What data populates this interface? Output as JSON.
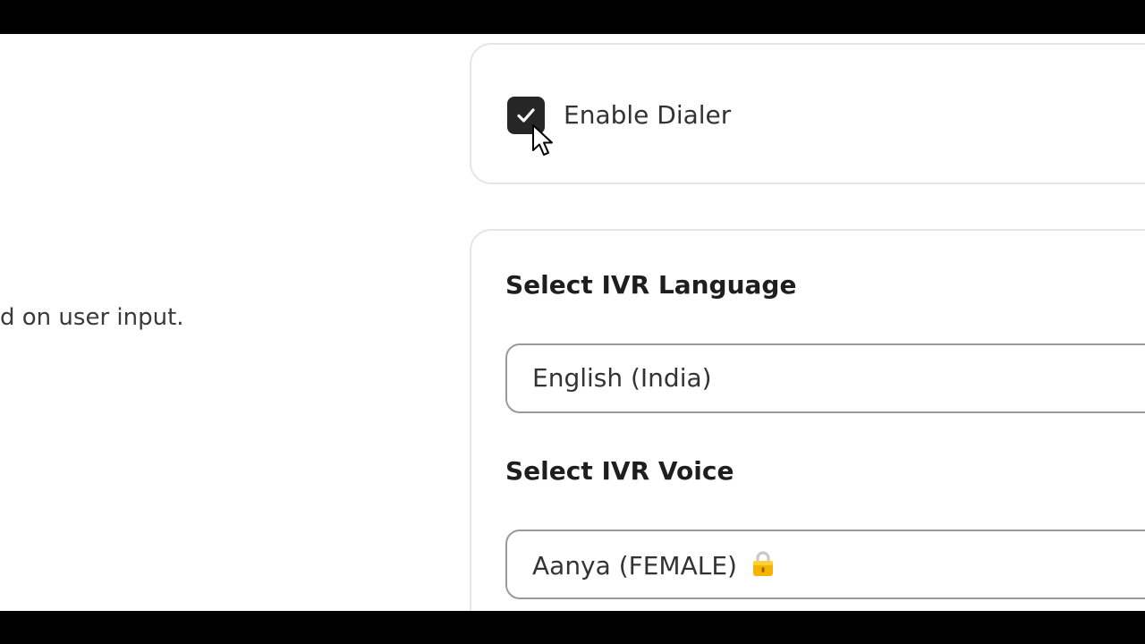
{
  "left_panel": {
    "description_fragment": "d on user input."
  },
  "dialer": {
    "checkbox_checked": true,
    "label": "Enable Dialer"
  },
  "ivr": {
    "language_label": "Select IVR Language",
    "language_value": "English (India)",
    "voice_label": "Select IVR Voice",
    "voice_value": "Aanya (FEMALE)",
    "voice_badge_icon": "lock-icon"
  },
  "colors": {
    "checkbox_fill": "#262626",
    "lock": "#f5b400"
  }
}
